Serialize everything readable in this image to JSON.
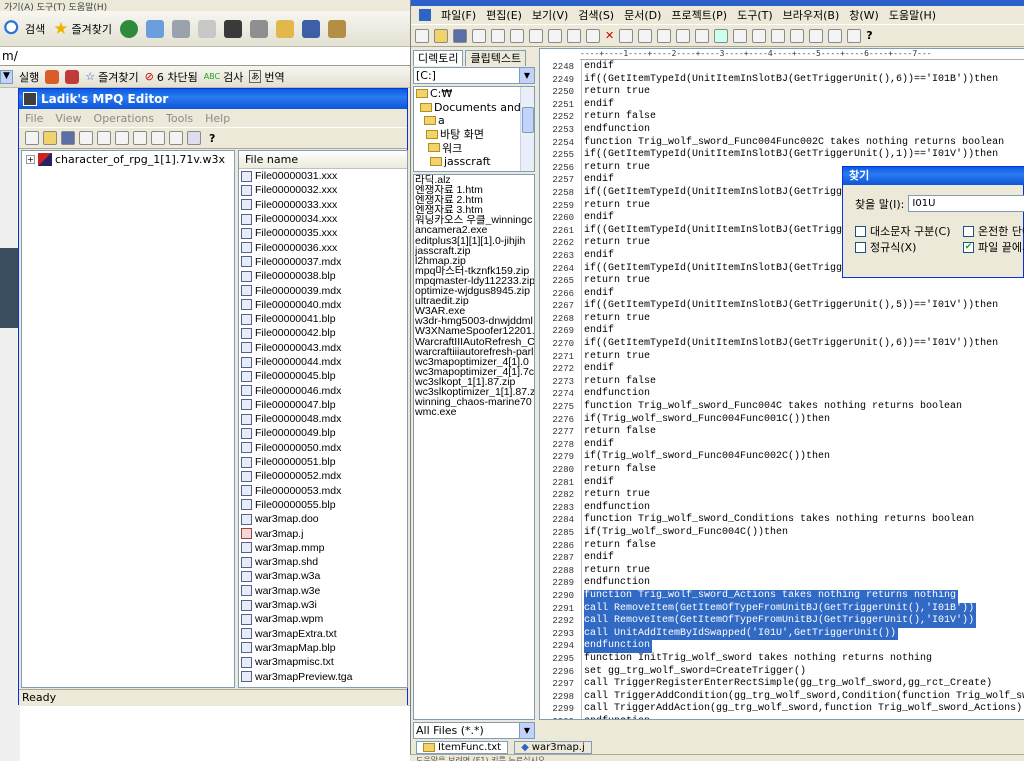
{
  "ie": {
    "menu_text": "가기(A)   도구(T)   도움말(H)",
    "toolbar1": {
      "search": "검색",
      "favorites": "즐겨찾기"
    },
    "address": "m/",
    "toolbar2": {
      "run": "실행",
      "favorites": "즐겨찾기",
      "blocked": "6 차단됨",
      "check": "검사",
      "translate": "번역"
    }
  },
  "mpq": {
    "title": "Ladik's MPQ Editor",
    "menu": [
      "File",
      "View",
      "Operations",
      "Tools",
      "Help"
    ],
    "tree_root": "character_of_rpg_1[1].71v.w3x",
    "list_header": "File name",
    "files": [
      "File00000031.xxx",
      "File00000032.xxx",
      "File00000033.xxx",
      "File00000034.xxx",
      "File00000035.xxx",
      "File00000036.xxx",
      "File00000037.mdx",
      "File00000038.blp",
      "File00000039.mdx",
      "File00000040.mdx",
      "File00000041.blp",
      "File00000042.blp",
      "File00000043.mdx",
      "File00000044.mdx",
      "File00000045.blp",
      "File00000046.mdx",
      "File00000047.blp",
      "File00000048.mdx",
      "File00000049.blp",
      "File00000050.mdx",
      "File00000051.blp",
      "File00000052.mdx",
      "File00000053.mdx",
      "File00000055.blp",
      "war3map.doo",
      "war3map.j",
      "war3map.mmp",
      "war3map.shd",
      "war3map.w3a",
      "war3map.w3e",
      "war3map.w3i",
      "war3map.wpm",
      "war3mapExtra.txt",
      "war3mapMap.blp",
      "war3mapmisc.txt",
      "war3mapPreview.tga"
    ],
    "status": "Ready"
  },
  "editor": {
    "menu": [
      "파일(F)",
      "편집(E)",
      "보기(V)",
      "검색(S)",
      "문서(D)",
      "프로젝트(P)",
      "도구(T)",
      "브라우저(B)",
      "창(W)",
      "도움말(H)"
    ],
    "tabs": {
      "directory": "디렉토리",
      "cliptext": "클립텍스트"
    },
    "drive": "[C:]",
    "dirs": [
      "C:₩",
      "Documents and Se",
      "a",
      "바탕 화면",
      "워크",
      "jasscraft"
    ],
    "files": [
      "라딕.alz",
      "엔쟁자료 1.htm",
      "엔쟁자료 2.htm",
      "엔쟁자료 3.htm",
      "워닝카오스 우클_winningc",
      "ancamera2.exe",
      "editplus3[1][1][1].0-jihjih",
      "jasscraft.zip",
      "l2hmap.zip",
      "mpq마스터-tkznfk159.zip",
      "mpqmaster-ldy112233.zip",
      "optimize-wjdgus8945.zip",
      "ultraedit.zip",
      "W3AR.exe",
      "w3dr-hmg5003-dnwjddml",
      "W3XNameSpoofer12201.e",
      "WarcraftIIIAutoRefresh_Co",
      "warcraftiiiautorefresh-parl",
      "wc3mapoptimizer_4[1].0",
      "wc3mapoptimizer_4[1].7c",
      "wc3slkopt_1[1].87.zip",
      "wc3slkoptimizer_1[1].87.z",
      "winning_chaos-marine70",
      "wmc.exe"
    ],
    "filter": "All Files (*.*)",
    "ruler": "----+----1----+----2----+----3----+----4----+----5----+----6----+----7---",
    "code_lines": [
      {
        "no": "2248",
        "text": "endif",
        "sel": false
      },
      {
        "no": "2249",
        "text": "if((GetItemTypeId(UnitItemInSlotBJ(GetTriggerUnit(),6))=='I01B'))then",
        "sel": false
      },
      {
        "no": "2250",
        "text": "return true",
        "sel": false
      },
      {
        "no": "2251",
        "text": "endif",
        "sel": false
      },
      {
        "no": "2252",
        "text": "return false",
        "sel": false
      },
      {
        "no": "2253",
        "text": "endfunction",
        "sel": false
      },
      {
        "no": "2254",
        "text": "function Trig_wolf_sword_Func004Func002C takes nothing returns boolean",
        "sel": false
      },
      {
        "no": "2255",
        "text": "if((GetItemTypeId(UnitItemInSlotBJ(GetTriggerUnit(),1))=='I01V'))then",
        "sel": false
      },
      {
        "no": "2256",
        "text": "return true",
        "sel": false
      },
      {
        "no": "2257",
        "text": "endif",
        "sel": false
      },
      {
        "no": "2258",
        "text": "if((GetItemTypeId(UnitItemInSlotBJ(GetTrigge",
        "sel": false
      },
      {
        "no": "2259",
        "text": "return true",
        "sel": false
      },
      {
        "no": "2260",
        "text": "endif",
        "sel": false
      },
      {
        "no": "2261",
        "text": "if((GetItemTypeId(UnitItemInSlotBJ(GetTrigge",
        "sel": false
      },
      {
        "no": "2262",
        "text": "return true",
        "sel": false
      },
      {
        "no": "2263",
        "text": "endif",
        "sel": false
      },
      {
        "no": "2264",
        "text": "if((GetItemTypeId(UnitItemInSlotBJ(GetTrigge",
        "sel": false
      },
      {
        "no": "2265",
        "text": "return true",
        "sel": false
      },
      {
        "no": "2266",
        "text": "endif",
        "sel": false
      },
      {
        "no": "2267",
        "text": "if((GetItemTypeId(UnitItemInSlotBJ(GetTriggerUnit(),5))=='I01V'))then",
        "sel": false
      },
      {
        "no": "2268",
        "text": "return true",
        "sel": false
      },
      {
        "no": "2269",
        "text": "endif",
        "sel": false
      },
      {
        "no": "2270",
        "text": "if((GetItemTypeId(UnitItemInSlotBJ(GetTriggerUnit(),6))=='I01V'))then",
        "sel": false
      },
      {
        "no": "2271",
        "text": "return true",
        "sel": false
      },
      {
        "no": "2272",
        "text": "endif",
        "sel": false
      },
      {
        "no": "2273",
        "text": "return false",
        "sel": false
      },
      {
        "no": "2274",
        "text": "endfunction",
        "sel": false
      },
      {
        "no": "2275",
        "text": "function Trig_wolf_sword_Func004C takes nothing returns boolean",
        "sel": false
      },
      {
        "no": "2276",
        "text": "if(Trig_wolf_sword_Func004Func001C())then",
        "sel": false
      },
      {
        "no": "2277",
        "text": "return false",
        "sel": false
      },
      {
        "no": "2278",
        "text": "endif",
        "sel": false
      },
      {
        "no": "2279",
        "text": "if(Trig_wolf_sword_Func004Func002C())then",
        "sel": false
      },
      {
        "no": "2280",
        "text": "return false",
        "sel": false
      },
      {
        "no": "2281",
        "text": "endif",
        "sel": false
      },
      {
        "no": "2282",
        "text": "return true",
        "sel": false
      },
      {
        "no": "2283",
        "text": "endfunction",
        "sel": false
      },
      {
        "no": "2284",
        "text": "function Trig_wolf_sword_Conditions takes nothing returns boolean",
        "sel": false
      },
      {
        "no": "2285",
        "text": "if(Trig_wolf_sword_Func004C())then",
        "sel": false
      },
      {
        "no": "2286",
        "text": "return false",
        "sel": false
      },
      {
        "no": "2287",
        "text": "endif",
        "sel": false
      },
      {
        "no": "2288",
        "text": "return true",
        "sel": false
      },
      {
        "no": "2289",
        "text": "endfunction",
        "sel": false
      },
      {
        "no": "2290",
        "text": "function Trig_wolf_sword_Actions takes nothing returns nothing",
        "sel": true
      },
      {
        "no": "2291",
        "text": "call RemoveItem(GetItemOfTypeFromUnitBJ(GetTriggerUnit(),'I01B'))",
        "sel": true
      },
      {
        "no": "2292",
        "text": "call RemoveItem(GetItemOfTypeFromUnitBJ(GetTriggerUnit(),'I01V'))",
        "sel": true
      },
      {
        "no": "2293",
        "text": "call UnitAddItemByIdSwapped('I01U',GetTriggerUnit())",
        "sel": true
      },
      {
        "no": "2294",
        "text": "endfunction",
        "sel": true
      },
      {
        "no": "2295",
        "text": "function InitTrig_wolf_sword takes nothing returns nothing",
        "sel": false
      },
      {
        "no": "2296",
        "text": "set gg_trg_wolf_sword=CreateTrigger()",
        "sel": false
      },
      {
        "no": "2297",
        "text": "call TriggerRegisterEnterRectSimple(gg_trg_wolf_sword,gg_rct_Create)",
        "sel": false
      },
      {
        "no": "2298",
        "text": "call TriggerAddCondition(gg_trg_wolf_sword,Condition(function Trig_wolf_swor",
        "sel": false
      },
      {
        "no": "2299",
        "text": "call TriggerAddAction(gg_trg_wolf_sword,function Trig_wolf_sword_Actions)",
        "sel": false
      },
      {
        "no": "2300",
        "text": "endfunction",
        "sel": false
      }
    ],
    "file_tabs": [
      "ItemFunc.txt",
      "war3map.j"
    ],
    "status_text": "도움말을 보려면 (F1) 키를 누르십시오"
  },
  "find": {
    "title": "찾기",
    "label": "찾을 말(I):",
    "value": "I01U",
    "case": "대소문자 구분(C)",
    "whole": "온전한 단어",
    "regex": "정규식(X)",
    "wrap": "파일 끝에서"
  }
}
